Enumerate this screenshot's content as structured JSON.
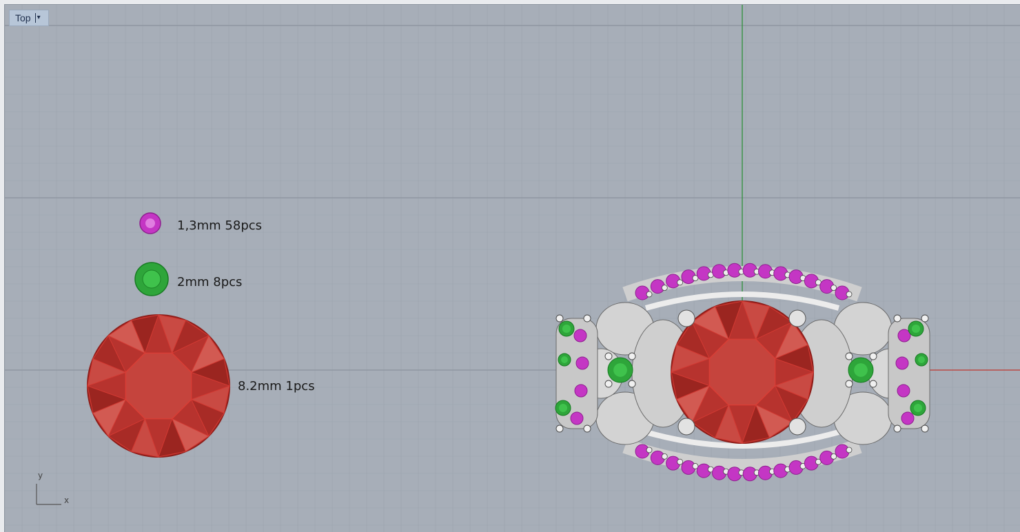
{
  "viewport": {
    "title": "Top",
    "caret": "▾",
    "background_color": "#a7aeb8",
    "grid_minor_color": "#9ba3ad",
    "grid_major_color": "#8a929d",
    "y_axis_color": "#2f8f3a",
    "x_axis_color": "#c23b33"
  },
  "legend": [
    {
      "label": "1,3mm 58pcs",
      "color": "#c436c4",
      "icon": "pink-stone-icon"
    },
    {
      "label": "2mm 8pcs",
      "color": "#2ea53a",
      "icon": "green-stone-icon"
    },
    {
      "label": "8.2mm 1pcs",
      "color": "#c63a34",
      "icon": "ruby-stone-icon"
    }
  ],
  "axis_labels": {
    "y": "y",
    "x": "x"
  },
  "metal_color": "#d9d9d9"
}
